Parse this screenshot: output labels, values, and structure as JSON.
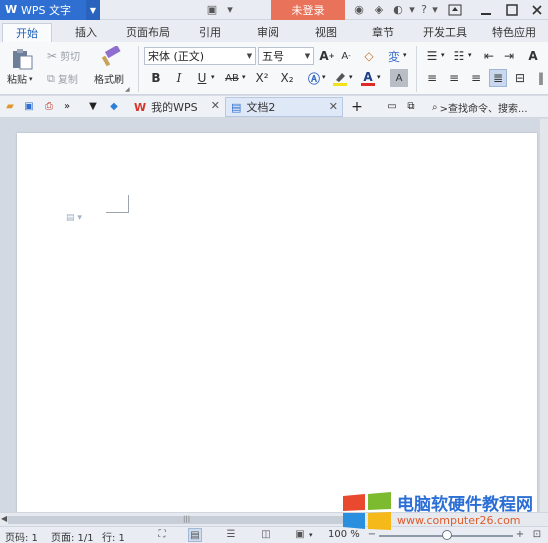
{
  "app": {
    "logo": "W",
    "name": "WPS 文字",
    "login_button": "未登录"
  },
  "ribbon_tabs": [
    {
      "label": "开始",
      "active": true
    },
    {
      "label": "插入"
    },
    {
      "label": "页面布局"
    },
    {
      "label": "引用"
    },
    {
      "label": "审阅"
    },
    {
      "label": "视图"
    },
    {
      "label": "章节"
    },
    {
      "label": "开发工具"
    },
    {
      "label": "特色应用"
    }
  ],
  "clipboard": {
    "paste": "粘贴",
    "cut": "剪切",
    "copy": "复制",
    "format_painter": "格式刷"
  },
  "font": {
    "family": "宋体 (正文)",
    "size": "五号",
    "bold": "B",
    "italic": "I",
    "underline": "U",
    "strikethrough": "AB",
    "superscript": "X²",
    "subscript": "X₂",
    "grow": "A",
    "shrink": "A",
    "font_color_letter": "A"
  },
  "quick_bar": {
    "tabs": [
      {
        "label": "我的WPS",
        "icon": "wps-logo-icon"
      },
      {
        "label": "文档2",
        "icon": "document-icon",
        "active": true
      }
    ],
    "add_tab": "+",
    "search_label": ">查找命令、搜索..."
  },
  "statusbar": {
    "page_code": "页码: 1",
    "pages": "页面: 1/1",
    "row": "行: 1",
    "zoom": "100 %"
  },
  "watermark": {
    "title": "电脑软硬件教程网",
    "url": "www.computer26.com"
  },
  "colors": {
    "accent": "#2f6fd1",
    "login": "#e8735a",
    "active_tab_text": "#1e5fb8"
  }
}
